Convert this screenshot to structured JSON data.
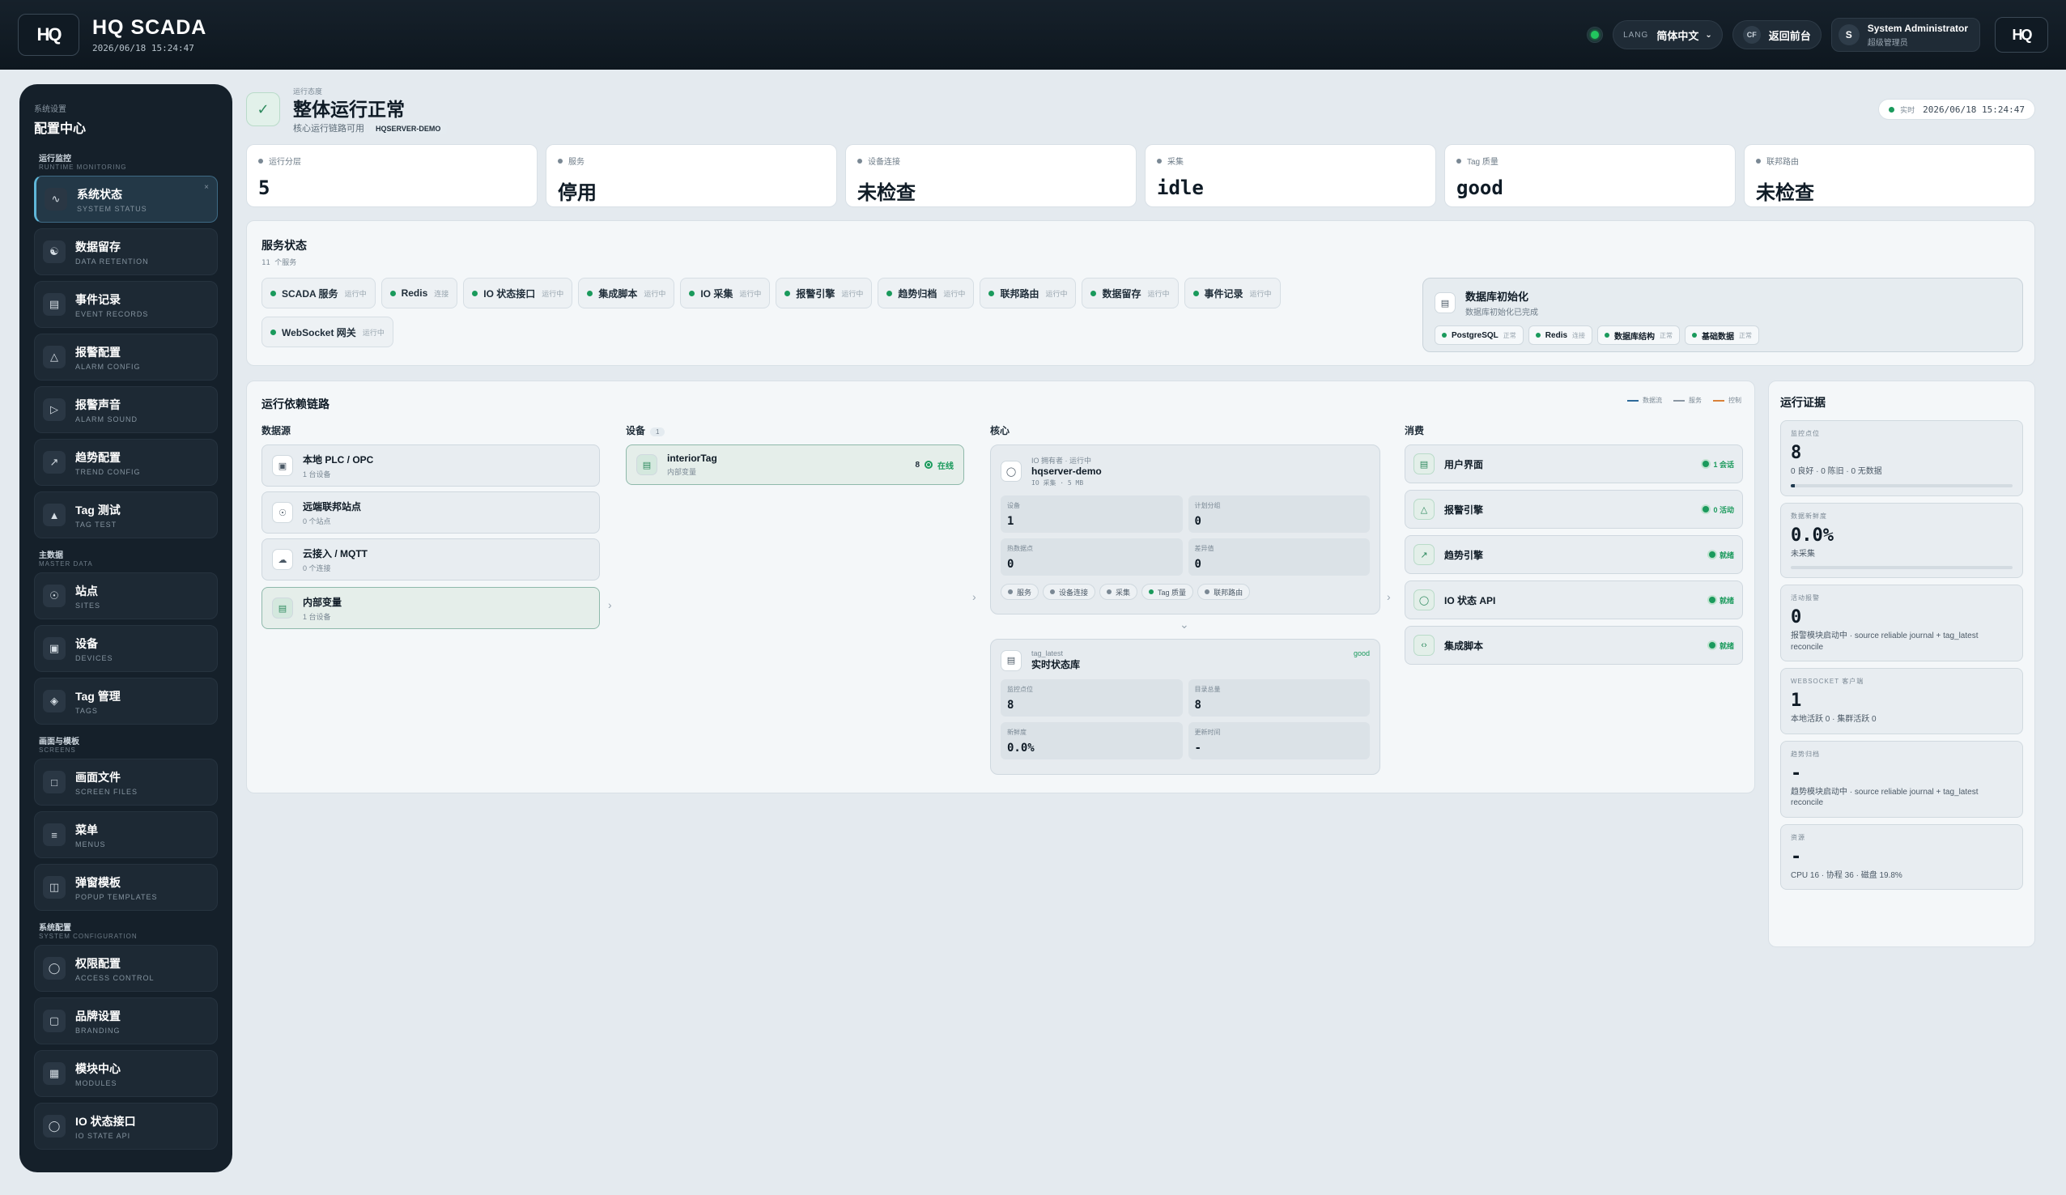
{
  "header": {
    "title": "HQ SCADA",
    "datetime": "2026/06/18 15:24:47",
    "lang_key": "LANG",
    "lang_value": "简体中文",
    "back_badge": "CF",
    "back_label": "返回前台",
    "user_initial": "S",
    "user_name": "System Administrator",
    "user_role": "超级管理员",
    "logo": "HQ"
  },
  "sidebar": {
    "small": "系统设置",
    "title": "配置中心",
    "groups": [
      {
        "label": "运行监控",
        "sub": "RUNTIME MONITORING"
      },
      {
        "label": "主数据",
        "sub": "MASTER DATA"
      },
      {
        "label": "画面与模板",
        "sub": "SCREENS"
      },
      {
        "label": "系统配置",
        "sub": "SYSTEM CONFIGURATION"
      }
    ],
    "items": [
      {
        "label": "系统状态",
        "sub": "SYSTEM STATUS",
        "icon": "pulse-icon"
      },
      {
        "label": "数据留存",
        "sub": "DATA RETENTION",
        "icon": "database-icon"
      },
      {
        "label": "事件记录",
        "sub": "EVENT RECORDS",
        "icon": "document-icon"
      },
      {
        "label": "报警配置",
        "sub": "ALARM CONFIG",
        "icon": "bell-icon"
      },
      {
        "label": "报警声音",
        "sub": "ALARM SOUND",
        "icon": "speaker-icon"
      },
      {
        "label": "趋势配置",
        "sub": "TREND CONFIG",
        "icon": "trend-icon"
      },
      {
        "label": "Tag 测试",
        "sub": "TAG TEST",
        "icon": "flask-icon"
      },
      {
        "label": "站点",
        "sub": "SITES",
        "icon": "network-icon"
      },
      {
        "label": "设备",
        "sub": "DEVICES",
        "icon": "device-icon"
      },
      {
        "label": "Tag 管理",
        "sub": "TAGS",
        "icon": "tag-icon"
      },
      {
        "label": "画面文件",
        "sub": "SCREEN FILES",
        "icon": "file-icon"
      },
      {
        "label": "菜单",
        "sub": "MENUS",
        "icon": "menu-icon"
      },
      {
        "label": "弹窗模板",
        "sub": "POPUP TEMPLATES",
        "icon": "popup-icon"
      },
      {
        "label": "权限配置",
        "sub": "ACCESS CONTROL",
        "icon": "shield-icon"
      },
      {
        "label": "品牌设置",
        "sub": "BRANDING",
        "icon": "brand-icon"
      },
      {
        "label": "模块中心",
        "sub": "MODULES",
        "icon": "modules-icon"
      },
      {
        "label": "IO 状态接口",
        "sub": "IO STATE API",
        "icon": "plug-icon"
      }
    ]
  },
  "overview": {
    "small": "运行态度",
    "title": "整体运行正常",
    "sub": "核心运行链路可用",
    "server": "HQSERVER-DEMO",
    "live_key": "实时",
    "live_time": "2026/06/18 15:24:47"
  },
  "stats": [
    {
      "label": "运行分层",
      "value": "5"
    },
    {
      "label": "服务",
      "value": "停用"
    },
    {
      "label": "设备连接",
      "value": "未检查"
    },
    {
      "label": "采集",
      "value": "idle"
    },
    {
      "label": "Tag 质量",
      "value": "good"
    },
    {
      "label": "联邦路由",
      "value": "未检查"
    }
  ],
  "services": {
    "title": "服务状态",
    "count": "11 个服务",
    "chips": [
      {
        "name": "SCADA 服务",
        "state": "运行中"
      },
      {
        "name": "Redis",
        "state": "连接"
      },
      {
        "name": "IO 状态接口",
        "state": "运行中"
      },
      {
        "name": "集成脚本",
        "state": "运行中"
      },
      {
        "name": "IO 采集",
        "state": "运行中"
      },
      {
        "name": "报警引擎",
        "state": "运行中"
      },
      {
        "name": "趋势归档",
        "state": "运行中"
      },
      {
        "name": "联邦路由",
        "state": "运行中"
      },
      {
        "name": "数据留存",
        "state": "运行中"
      },
      {
        "name": "事件记录",
        "state": "运行中"
      },
      {
        "name": "WebSocket 网关",
        "state": "运行中"
      }
    ],
    "db": {
      "title": "数据库初始化",
      "sub": "数据库初始化已完成",
      "chips": [
        {
          "name": "PostgreSQL",
          "state": "正常"
        },
        {
          "name": "Redis",
          "state": "连接"
        },
        {
          "name": "数据库结构",
          "state": "正常"
        },
        {
          "name": "基础数据",
          "state": "正常"
        }
      ]
    }
  },
  "dependency": {
    "title": "运行依赖链路",
    "legend": [
      "数据流",
      "服务",
      "控制"
    ],
    "cols": {
      "sources": "数据源",
      "devices": "设备",
      "devices_count": "1",
      "core": "核心",
      "consumers": "消费"
    },
    "sources": [
      {
        "name": "本地 PLC / OPC",
        "sub": "1 台设备",
        "icon": "plc-icon"
      },
      {
        "name": "远端联邦站点",
        "sub": "0 个站点",
        "icon": "globe-icon"
      },
      {
        "name": "云接入 / MQTT",
        "sub": "0 个连接",
        "icon": "cloud-icon"
      },
      {
        "name": "内部变量",
        "sub": "1 台设备",
        "icon": "variable-icon"
      }
    ],
    "device": {
      "name": "interiorTag",
      "sub": "内部变量",
      "count": "8",
      "state": "在线"
    },
    "io_core": {
      "small": "IO 拥有者 · 运行中",
      "name": "hqserver-demo",
      "sub": "IO 采集 · 5 MB",
      "kv": [
        {
          "k": "设备",
          "v": "1"
        },
        {
          "k": "计划分组",
          "v": "0"
        },
        {
          "k": "热数据点",
          "v": "0"
        },
        {
          "k": "差异值",
          "v": "0"
        }
      ],
      "tags": [
        "服务",
        "设备连接",
        "采集",
        "Tag 质量",
        "联邦路由"
      ]
    },
    "tag_latest": {
      "small": "tag_latest",
      "name": "实时状态库",
      "state": "good",
      "kv": [
        {
          "k": "监控点位",
          "v": "8"
        },
        {
          "k": "目录总量",
          "v": "8"
        },
        {
          "k": "新鲜度",
          "v": "0.0%"
        },
        {
          "k": "更新时间",
          "v": "-"
        }
      ]
    },
    "consumers": [
      {
        "name": "用户界面",
        "state": "1 会话",
        "icon": "ui-icon"
      },
      {
        "name": "报警引擎",
        "state": "0 活动",
        "icon": "alarm-icon"
      },
      {
        "name": "趋势引擎",
        "state": "就绪",
        "icon": "chart-icon"
      },
      {
        "name": "IO 状态 API",
        "state": "就绪",
        "icon": "api-icon"
      },
      {
        "name": "集成脚本",
        "state": "就绪",
        "icon": "code-icon"
      }
    ]
  },
  "evidence": {
    "title": "运行证据",
    "items": [
      {
        "k": "监控点位",
        "v": "8",
        "d": "0 良好 · 0 陈旧 · 0 无数据",
        "bar": 0.02
      },
      {
        "k": "数据新鲜度",
        "v": "0.0%",
        "d": "未采集",
        "bar": 0.0
      },
      {
        "k": "活动报警",
        "v": "0",
        "d": "报警模块启动中 · source reliable journal + tag_latest reconcile"
      },
      {
        "k": "WEBSOCKET 客户端",
        "v": "1",
        "d": "本地活跃 0 · 集群活跃 0"
      },
      {
        "k": "趋势归档",
        "v": "-",
        "d": "趋势模块启动中 · source reliable journal + tag_latest reconcile"
      },
      {
        "k": "资源",
        "v": "-",
        "d": "CPU 16 · 协程 36 · 磁盘 19.8%"
      }
    ]
  }
}
